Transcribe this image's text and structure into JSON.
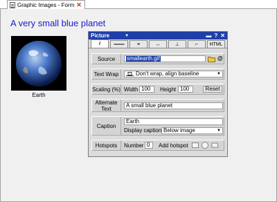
{
  "tab": {
    "title": "Graphic Images - Form"
  },
  "page": {
    "heading": "A very small blue planet",
    "image_caption": "Earth"
  },
  "panel": {
    "title": "Picture",
    "controls": {
      "dropdown": "▼",
      "pin": "▬",
      "help": "?",
      "close": "✕"
    },
    "tabs": [
      {
        "label": "i",
        "icon": "info-icon"
      },
      {
        "label": "═══",
        "icon": "border-icon"
      },
      {
        "label": "≡",
        "icon": "align-icon"
      },
      {
        "label": "↔",
        "icon": "spacing-icon"
      },
      {
        "label": "⊥",
        "icon": "position-icon"
      },
      {
        "label": "⌐",
        "icon": "link-icon"
      },
      {
        "label": "HTML",
        "icon": "html-icon"
      }
    ],
    "source": {
      "label": "Source",
      "value": "smallearth.gif"
    },
    "text_wrap": {
      "label": "Text Wrap",
      "value": "Don't wrap, align baseline"
    },
    "scaling": {
      "label": "Scaling (%)",
      "width_label": "Width",
      "width_value": "100",
      "height_label": "Height",
      "height_value": "100",
      "reset_label": "Reset"
    },
    "alternate_text": {
      "label": "Alternate Text",
      "value": "A small blue planet"
    },
    "caption": {
      "label": "Caption",
      "value": "Earth",
      "display_label": "Display caption",
      "display_value": "Below image"
    },
    "hotspots": {
      "label": "Hotspots",
      "number_label": "Number",
      "number_value": "0",
      "add_label": "Add hotspot"
    }
  }
}
